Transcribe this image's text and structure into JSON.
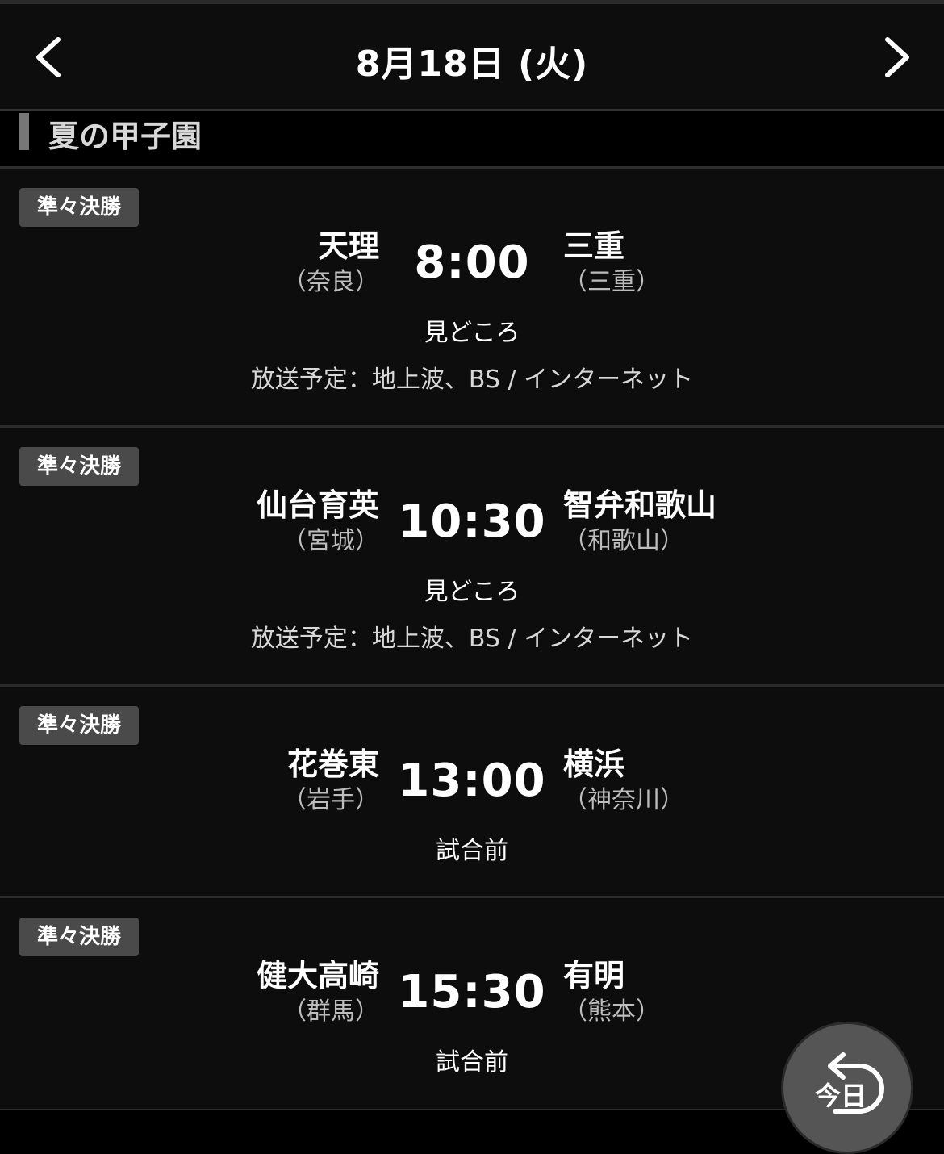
{
  "header": {
    "date": "8月18日 (火)"
  },
  "section": {
    "title": "夏の甲子園"
  },
  "matches": [
    {
      "round": "準々決勝",
      "home": {
        "name": "天理",
        "pref": "（奈良）"
      },
      "time": "8:00",
      "away": {
        "name": "三重",
        "pref": "（三重）"
      },
      "highlight": "見どころ",
      "broadcast": "放送予定：地上波、BS / インターネット"
    },
    {
      "round": "準々決勝",
      "home": {
        "name": "仙台育英",
        "pref": "（宮城）"
      },
      "time": "10:30",
      "away": {
        "name": "智弁和歌山",
        "pref": "（和歌山）"
      },
      "highlight": "見どころ",
      "broadcast": "放送予定：地上波、BS / インターネット"
    },
    {
      "round": "準々決勝",
      "home": {
        "name": "花巻東",
        "pref": "（岩手）"
      },
      "time": "13:00",
      "away": {
        "name": "横浜",
        "pref": "（神奈川）"
      },
      "status": "試合前"
    },
    {
      "round": "準々決勝",
      "home": {
        "name": "健大高崎",
        "pref": "（群馬）"
      },
      "time": "15:30",
      "away": {
        "name": "有明",
        "pref": "（熊本）"
      },
      "status": "試合前"
    }
  ],
  "today_button": {
    "label": "今日",
    "icon": "return-arrow-icon"
  },
  "icons": {
    "prev": "chevron-left-icon",
    "next": "chevron-right-icon"
  }
}
